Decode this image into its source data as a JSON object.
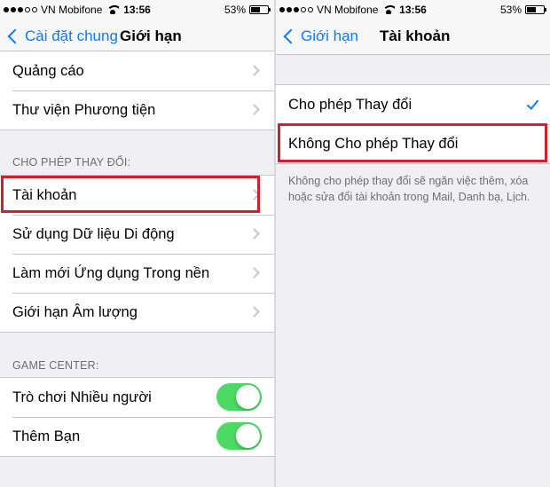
{
  "left": {
    "status": {
      "carrier": "VN Mobifone",
      "time": "13:56",
      "battery": "53%",
      "battery_level": 0.53
    },
    "nav": {
      "back_label": "Cài đặt chung",
      "title": "Giới hạn"
    },
    "top_rows": [
      "Quảng cáo",
      "Thư viện Phương tiện"
    ],
    "section_allow": "CHO PHÉP THAY ĐỔI:",
    "allow_rows": [
      "Tài khoản",
      "Sử dụng Dữ liệu Di động",
      "Làm mới Ứng dụng Trong nền",
      "Giới hạn Âm lượng"
    ],
    "section_game": "GAME CENTER:",
    "game_rows": [
      {
        "label": "Trò chơi Nhiều người",
        "on": true
      },
      {
        "label": "Thêm Bạn",
        "on": true
      }
    ]
  },
  "right": {
    "status": {
      "carrier": "VN Mobifone",
      "time": "13:56",
      "battery": "53%",
      "battery_level": 0.53
    },
    "nav": {
      "back_label": "Giới hạn",
      "title": "Tài khoản"
    },
    "options": [
      {
        "label": "Cho phép Thay đổi",
        "selected": true
      },
      {
        "label": "Không Cho phép Thay đổi",
        "selected": false
      }
    ],
    "footer": "Không cho phép thay đổi sẽ ngăn việc thêm, xóa hoặc sửa đổi tài khoản trong Mail, Danh bạ, Lịch."
  },
  "colors": {
    "accent": "#0a7aff",
    "toggle_on": "#4cd964",
    "highlight": "#d21f2e"
  }
}
